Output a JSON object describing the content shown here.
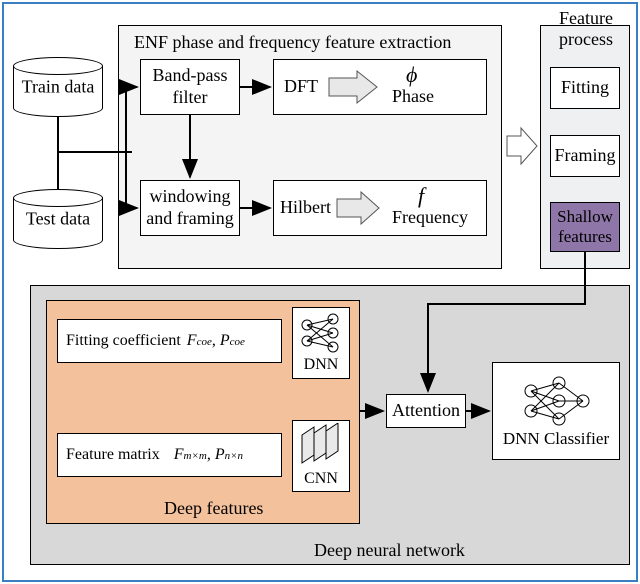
{
  "data_sources": {
    "train": "Train data",
    "test": "Test data"
  },
  "extraction": {
    "panel_title": "ENF phase and frequency feature extraction",
    "bandpass": "Band-pass\nfilter",
    "windowing": "windowing\nand framing",
    "dft": "DFT",
    "phase_sym": "ϕ",
    "phase_lbl": "Phase",
    "hilbert": "Hilbert",
    "freq_sym": "f",
    "freq_lbl": "Frequency"
  },
  "process": {
    "panel_title": "Feature\nprocess",
    "fitting": "Fitting",
    "framing": "Framing",
    "shallow": "Shallow\nfeatures"
  },
  "nn": {
    "panel_title": "Deep neural network",
    "deep_title": "Deep features",
    "fitting_coef_lbl": "Fitting coefficient",
    "F": "F",
    "coe": "coe",
    "P": "P",
    "feature_matrix_lbl": "Feature matrix",
    "mm": "m×m",
    "nn": "n×n",
    "dnn": "DNN",
    "cnn": "CNN",
    "attention": "Attention",
    "classifier": "DNN Classifier"
  }
}
